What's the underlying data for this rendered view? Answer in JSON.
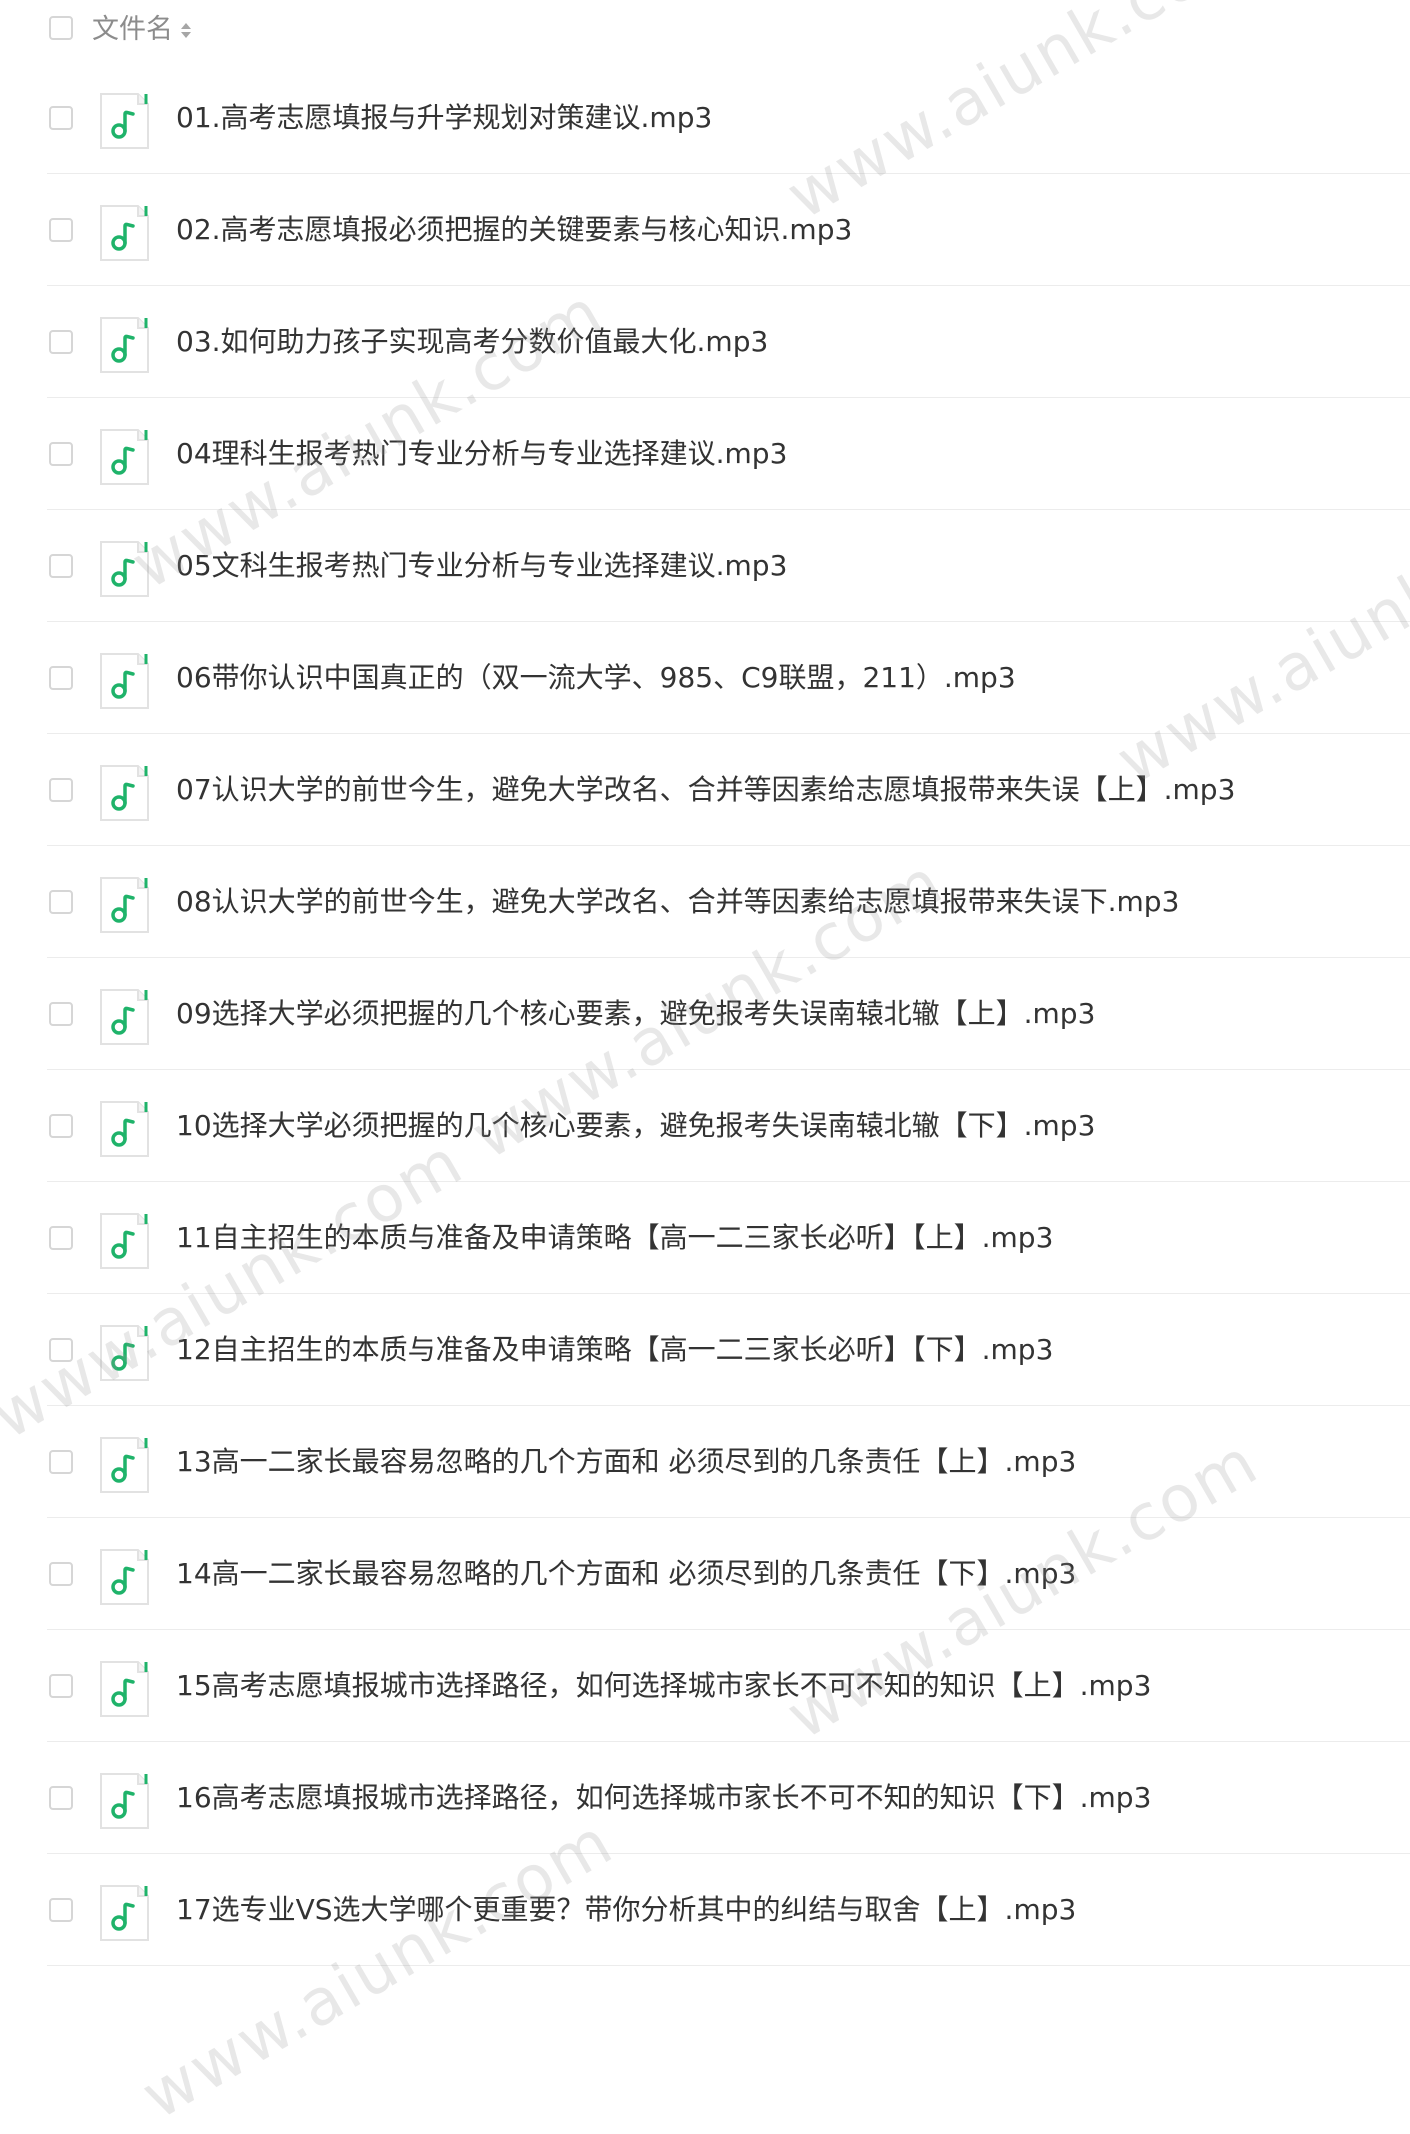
{
  "header": {
    "column_label": "文件名"
  },
  "files": [
    {
      "name": "01.高考志愿填报与升学规划对策建议.mp3"
    },
    {
      "name": "02.高考志愿填报必须把握的关键要素与核心知识.mp3"
    },
    {
      "name": "03.如何助力孩子实现高考分数价值最大化.mp3"
    },
    {
      "name": "04理科生报考热门专业分析与专业选择建议.mp3"
    },
    {
      "name": "05文科生报考热门专业分析与专业选择建议.mp3"
    },
    {
      "name": "06带你认识中国真正的（双一流大学、985、C9联盟，211）.mp3"
    },
    {
      "name": "07认识大学的前世今生，避免大学改名、合并等因素给志愿填报带来失误【上】.mp3"
    },
    {
      "name": "08认识大学的前世今生，避免大学改名、合并等因素给志愿填报带来失误下.mp3"
    },
    {
      "name": "09选择大学必须把握的几个核心要素，避免报考失误南辕北辙【上】.mp3"
    },
    {
      "name": "10选择大学必须把握的几个核心要素，避免报考失误南辕北辙【下】.mp3"
    },
    {
      "name": "11自主招生的本质与准备及申请策略【高一二三家长必听】【上】.mp3"
    },
    {
      "name": "12自主招生的本质与准备及申请策略【高一二三家长必听】【下】.mp3"
    },
    {
      "name": "13高一二家长最容易忽略的几个方面和 必须尽到的几条责任【上】.mp3"
    },
    {
      "name": "14高一二家长最容易忽略的几个方面和 必须尽到的几条责任【下】.mp3"
    },
    {
      "name": "15高考志愿填报城市选择路径，如何选择城市家长不可不知的知识【上】.mp3"
    },
    {
      "name": "16高考志愿填报城市选择路径，如何选择城市家长不可不知的知识【下】.mp3"
    },
    {
      "name": "17选专业VS选大学哪个更重要？带你分析其中的纠结与取舍【上】.mp3"
    }
  ],
  "watermark_text": "www.aiunk.com",
  "colors": {
    "icon_green": "#1fb36a",
    "icon_bg": "#ffffff",
    "divider": "#ececec",
    "text": "#333333",
    "header_text": "#8c8c8c"
  }
}
